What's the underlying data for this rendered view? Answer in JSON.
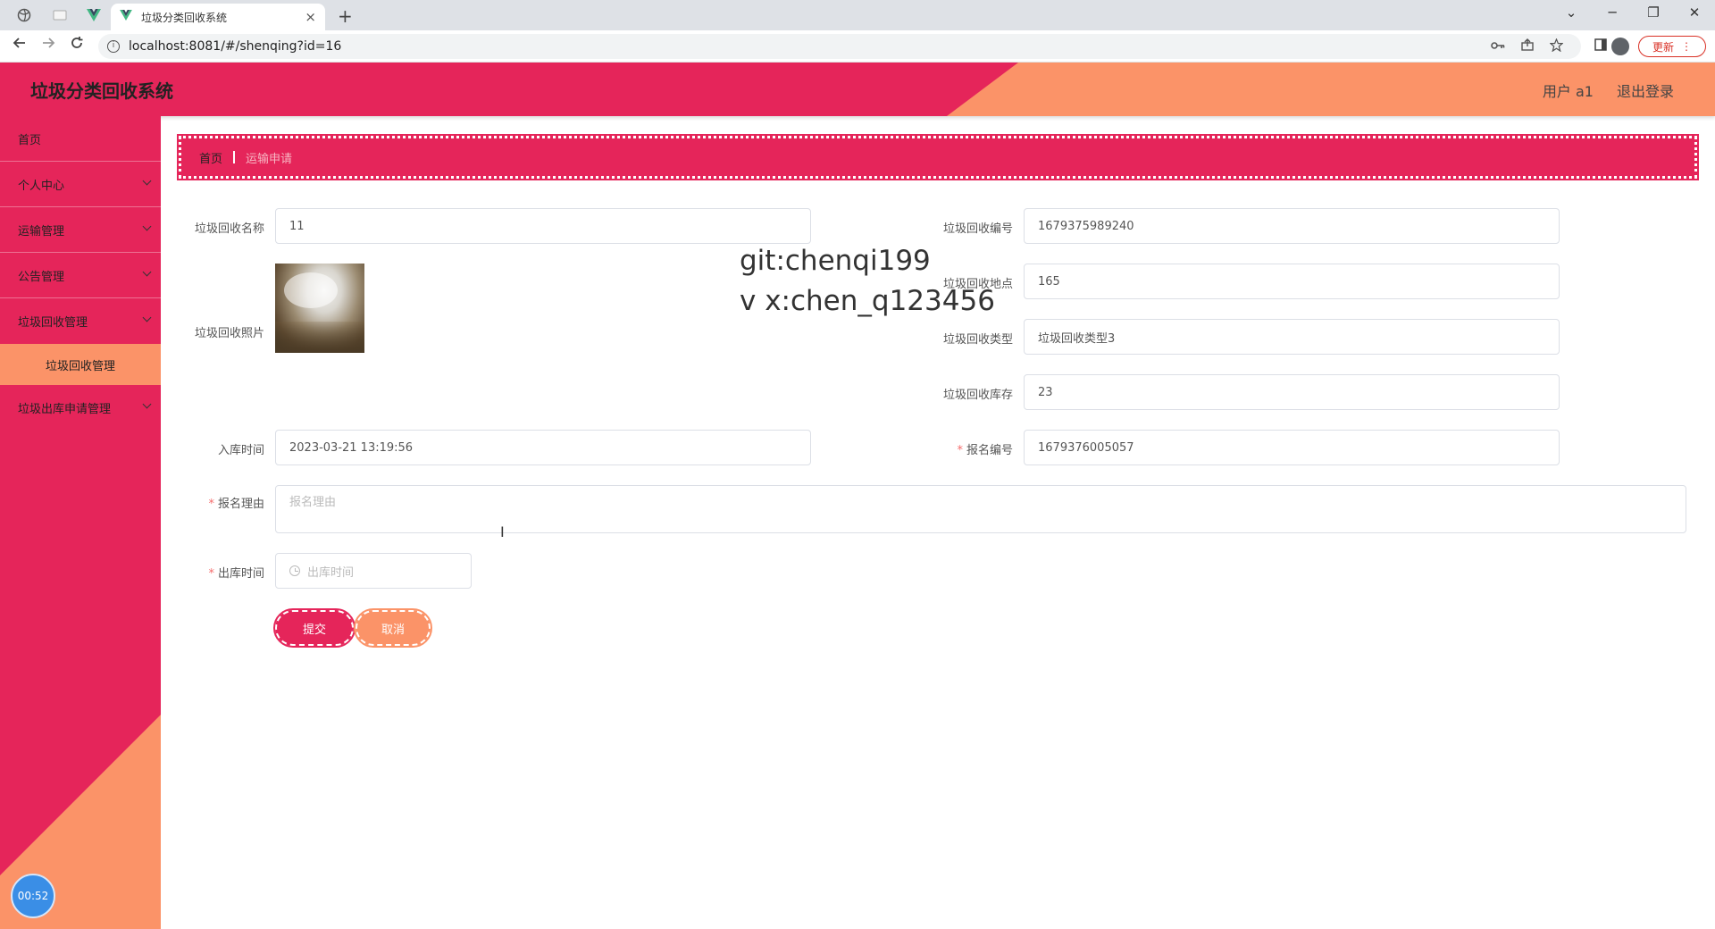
{
  "browser": {
    "tab_title": "垃圾分类回收系统",
    "tab_close": "×",
    "new_tab": "+",
    "url": "localhost:8081/#/shenqing?id=16",
    "update_label": "更新",
    "win_min": "─",
    "win_max": "❐",
    "win_close": "✕",
    "chevron": "⌄"
  },
  "header": {
    "title": "垃圾分类回收系统",
    "user": "用户 a1",
    "logout": "退出登录"
  },
  "sidebar": {
    "items": [
      {
        "label": "首页"
      },
      {
        "label": "个人中心"
      },
      {
        "label": "运输管理"
      },
      {
        "label": "公告管理"
      },
      {
        "label": "垃圾回收管理"
      },
      {
        "label": "垃圾出库申请管理"
      }
    ],
    "sub_item": "垃圾回收管理",
    "timer": "00:52"
  },
  "breadcrumb": {
    "home": "首页",
    "current": "运输申请"
  },
  "form": {
    "name_label": "垃圾回收名称",
    "name_value": "11",
    "code_label": "垃圾回收编号",
    "code_value": "1679375989240",
    "photo_label": "垃圾回收照片",
    "location_label": "垃圾回收地点",
    "location_value": "165",
    "type_label": "垃圾回收类型",
    "type_value": "垃圾回收类型3",
    "stock_label": "垃圾回收库存",
    "stock_value": "23",
    "intime_label": "入库时间",
    "intime_value": "2023-03-21 13:19:56",
    "regno_label": "报名编号",
    "regno_value": "1679376005057",
    "reason_label": "报名理由",
    "reason_placeholder": "报名理由",
    "outtime_label": "出库时间",
    "outtime_placeholder": "出库时间",
    "required_mark": "*",
    "submit": "提交",
    "cancel": "取消"
  },
  "watermark": {
    "line1": "git:chenqi199",
    "line2": "v x:chen_q123456"
  }
}
